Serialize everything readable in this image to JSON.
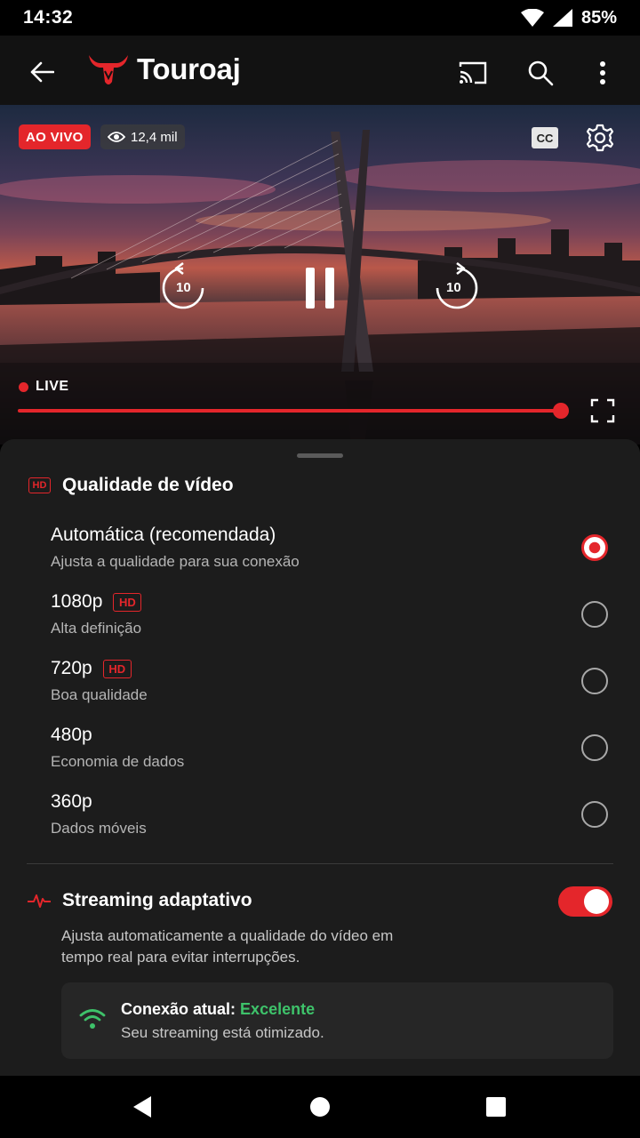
{
  "status_bar": {
    "time": "14:32",
    "battery": "85%"
  },
  "app_bar": {
    "brand": "Touroaj"
  },
  "player": {
    "live_badge": "AO VIVO",
    "viewers": "12,4 mil",
    "cc_label": "CC",
    "rewind_seconds": "10",
    "forward_seconds": "10",
    "live_label": "LIVE",
    "progress": 1.0,
    "accent": "#e4262b"
  },
  "quality": {
    "hd_tag": "HD",
    "title": "Qualidade de vídeo",
    "options": [
      {
        "label": "Automática (recomendada)",
        "hd": "",
        "sub": "Ajusta a qualidade para sua conexão",
        "selected": true
      },
      {
        "label": "1080p",
        "hd": "HD",
        "sub": "Alta definição",
        "selected": false
      },
      {
        "label": "720p",
        "hd": "HD",
        "sub": "Boa qualidade",
        "selected": false
      },
      {
        "label": "480p",
        "hd": "",
        "sub": "Economia de dados",
        "selected": false
      },
      {
        "label": "360p",
        "hd": "",
        "sub": "Dados móveis",
        "selected": false
      }
    ]
  },
  "adaptive": {
    "title": "Streaming adaptativo",
    "description": "Ajusta automaticamente a qualidade do vídeo em tempo real para evitar interrupções.",
    "enabled": true,
    "connection_label": "Conexão atual:",
    "connection_value": "Excelente",
    "connection_sub": "Seu streaming está otimizado.",
    "connection_color": "#3ec26a"
  },
  "icons": [
    "back-icon",
    "bull-logo-icon",
    "cast-icon",
    "search-icon",
    "more-icon",
    "eye-icon",
    "gear-icon",
    "rewind-icon",
    "pause-icon",
    "forward-icon",
    "fullscreen-icon",
    "pulse-icon",
    "wifi-icon"
  ]
}
